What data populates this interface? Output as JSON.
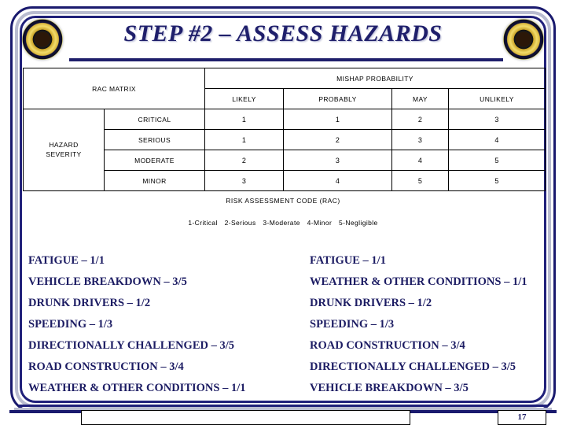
{
  "slide": {
    "title": "STEP #2 – ASSESS HAZARDS",
    "page_number": "17",
    "seal_name": "unit-seal",
    "accent_navy": "#1f1f6b",
    "accent_silver": "#b9bcd0",
    "text_color": "#1c1c63"
  },
  "matrix": {
    "corner_label": "RAC MATRIX",
    "column_group_header": "MISHAP PROBABILITY",
    "probability_headers": [
      "LIKELY",
      "PROBABLY",
      "MAY",
      "UNLIKELY"
    ],
    "severity_label": "HAZARD SEVERITY",
    "severity_label_line1": "HAZARD",
    "severity_label_line2": "SEVERITY",
    "rows": [
      {
        "severity": "CRITICAL",
        "values": [
          "1",
          "1",
          "2",
          "3"
        ]
      },
      {
        "severity": "SERIOUS",
        "values": [
          "1",
          "2",
          "3",
          "4"
        ]
      },
      {
        "severity": "MODERATE",
        "values": [
          "2",
          "3",
          "4",
          "5"
        ]
      },
      {
        "severity": "MINOR",
        "values": [
          "3",
          "4",
          "5",
          "5"
        ]
      }
    ],
    "caption": "RISK ASSESSMENT CODE (RAC)",
    "legend": [
      "1-Critical",
      "2-Serious",
      "3-Moderate",
      "4-Minor",
      "5-Negligible"
    ]
  },
  "hazard_lists": {
    "left": [
      "FATIGUE – 1/1",
      "VEHICLE BREAKDOWN – 3/5",
      "DRUNK DRIVERS – 1/2",
      "SPEEDING – 1/3",
      "DIRECTIONALLY CHALLENGED – 3/5",
      "ROAD CONSTRUCTION – 3/4",
      "WEATHER & OTHER CONDITIONS – 1/1"
    ],
    "right": [
      "FATIGUE – 1/1",
      "WEATHER & OTHER CONDITIONS – 1/1",
      "DRUNK DRIVERS – 1/2",
      "SPEEDING – 1/3",
      "ROAD CONSTRUCTION – 3/4",
      "DIRECTIONALLY CHALLENGED – 3/5",
      "VEHICLE BREAKDOWN – 3/5"
    ]
  },
  "footer": {
    "notes_box_text": ""
  }
}
